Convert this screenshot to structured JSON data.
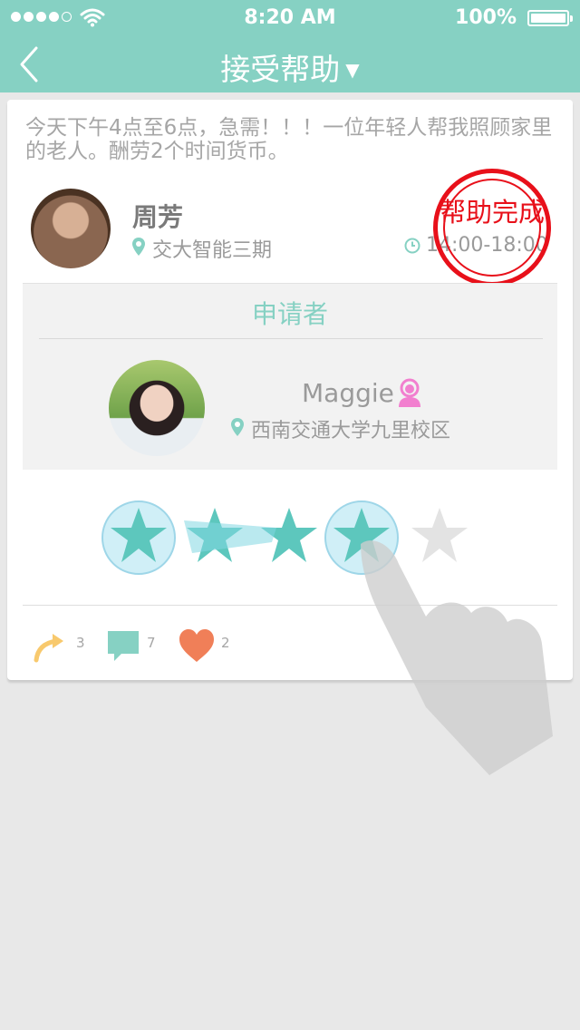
{
  "status_bar": {
    "time": "8:20 AM",
    "battery": "100%"
  },
  "nav": {
    "title": "接受帮助",
    "dropdown_arrow": "▼"
  },
  "post": {
    "text": "今天下午4点至6点，急需！！！一位年轻人帮我照顾家里的老人。酬劳2个时间货币。",
    "poster_name": "周芳",
    "poster_location": "交大智能三期",
    "time": "14:00-18:00",
    "stamp_text": "帮助完成"
  },
  "applicant": {
    "section_label": "申请者",
    "name": "Maggie",
    "location": "西南交通大学九里校区"
  },
  "rating": {
    "value": 4,
    "max": 5,
    "active_color": "#5dc7bd",
    "inactive_color": "#e3e3e3"
  },
  "actions": {
    "share_count": "3",
    "comment_count": "7",
    "like_count": "2"
  },
  "colors": {
    "accent": "#86d1c3",
    "stamp_red": "#e8101a",
    "heart": "#f07f58",
    "share": "#f8c96d"
  }
}
